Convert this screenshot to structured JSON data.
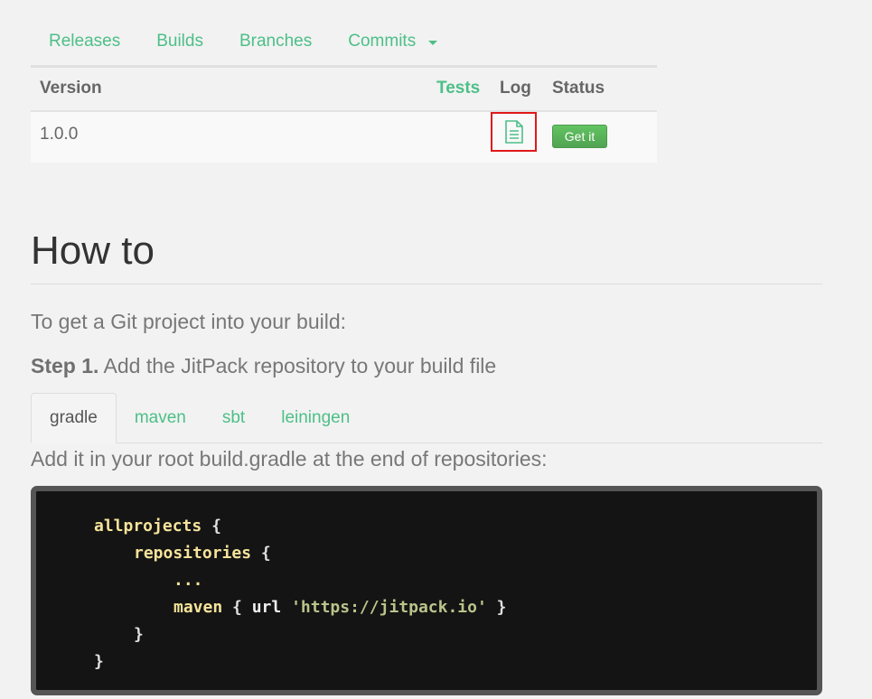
{
  "top_tabs": {
    "releases": "Releases",
    "builds": "Builds",
    "branches": "Branches",
    "commits": "Commits"
  },
  "table": {
    "headers": {
      "version": "Version",
      "tests": "Tests",
      "log": "Log",
      "status": "Status"
    },
    "rows": [
      {
        "version": "1.0.0",
        "status_button": "Get it"
      }
    ]
  },
  "howto": {
    "title": "How to",
    "intro": "To get a Git project into your build:",
    "step_label": "Step 1.",
    "step_text": "Add the JitPack repository to your build file",
    "lang_tabs": [
      "gradle",
      "maven",
      "sbt",
      "leiningen"
    ],
    "instruction": "Add it in your root build.gradle at the end of repositories:",
    "code": {
      "l1_kw": "allprojects",
      "l1_br": "{",
      "l2_kw": "repositories",
      "l2_br": "{",
      "l3": "...",
      "l4_kw": "maven",
      "l4_br1": "{",
      "l4_url": "url",
      "l4_str": "'https://jitpack.io'",
      "l4_br2": "}",
      "l5": "}",
      "l6": "}"
    }
  },
  "colors": {
    "accent": "#4dbf88",
    "highlight_border": "#e01919",
    "button_green": "#5cb85c"
  }
}
